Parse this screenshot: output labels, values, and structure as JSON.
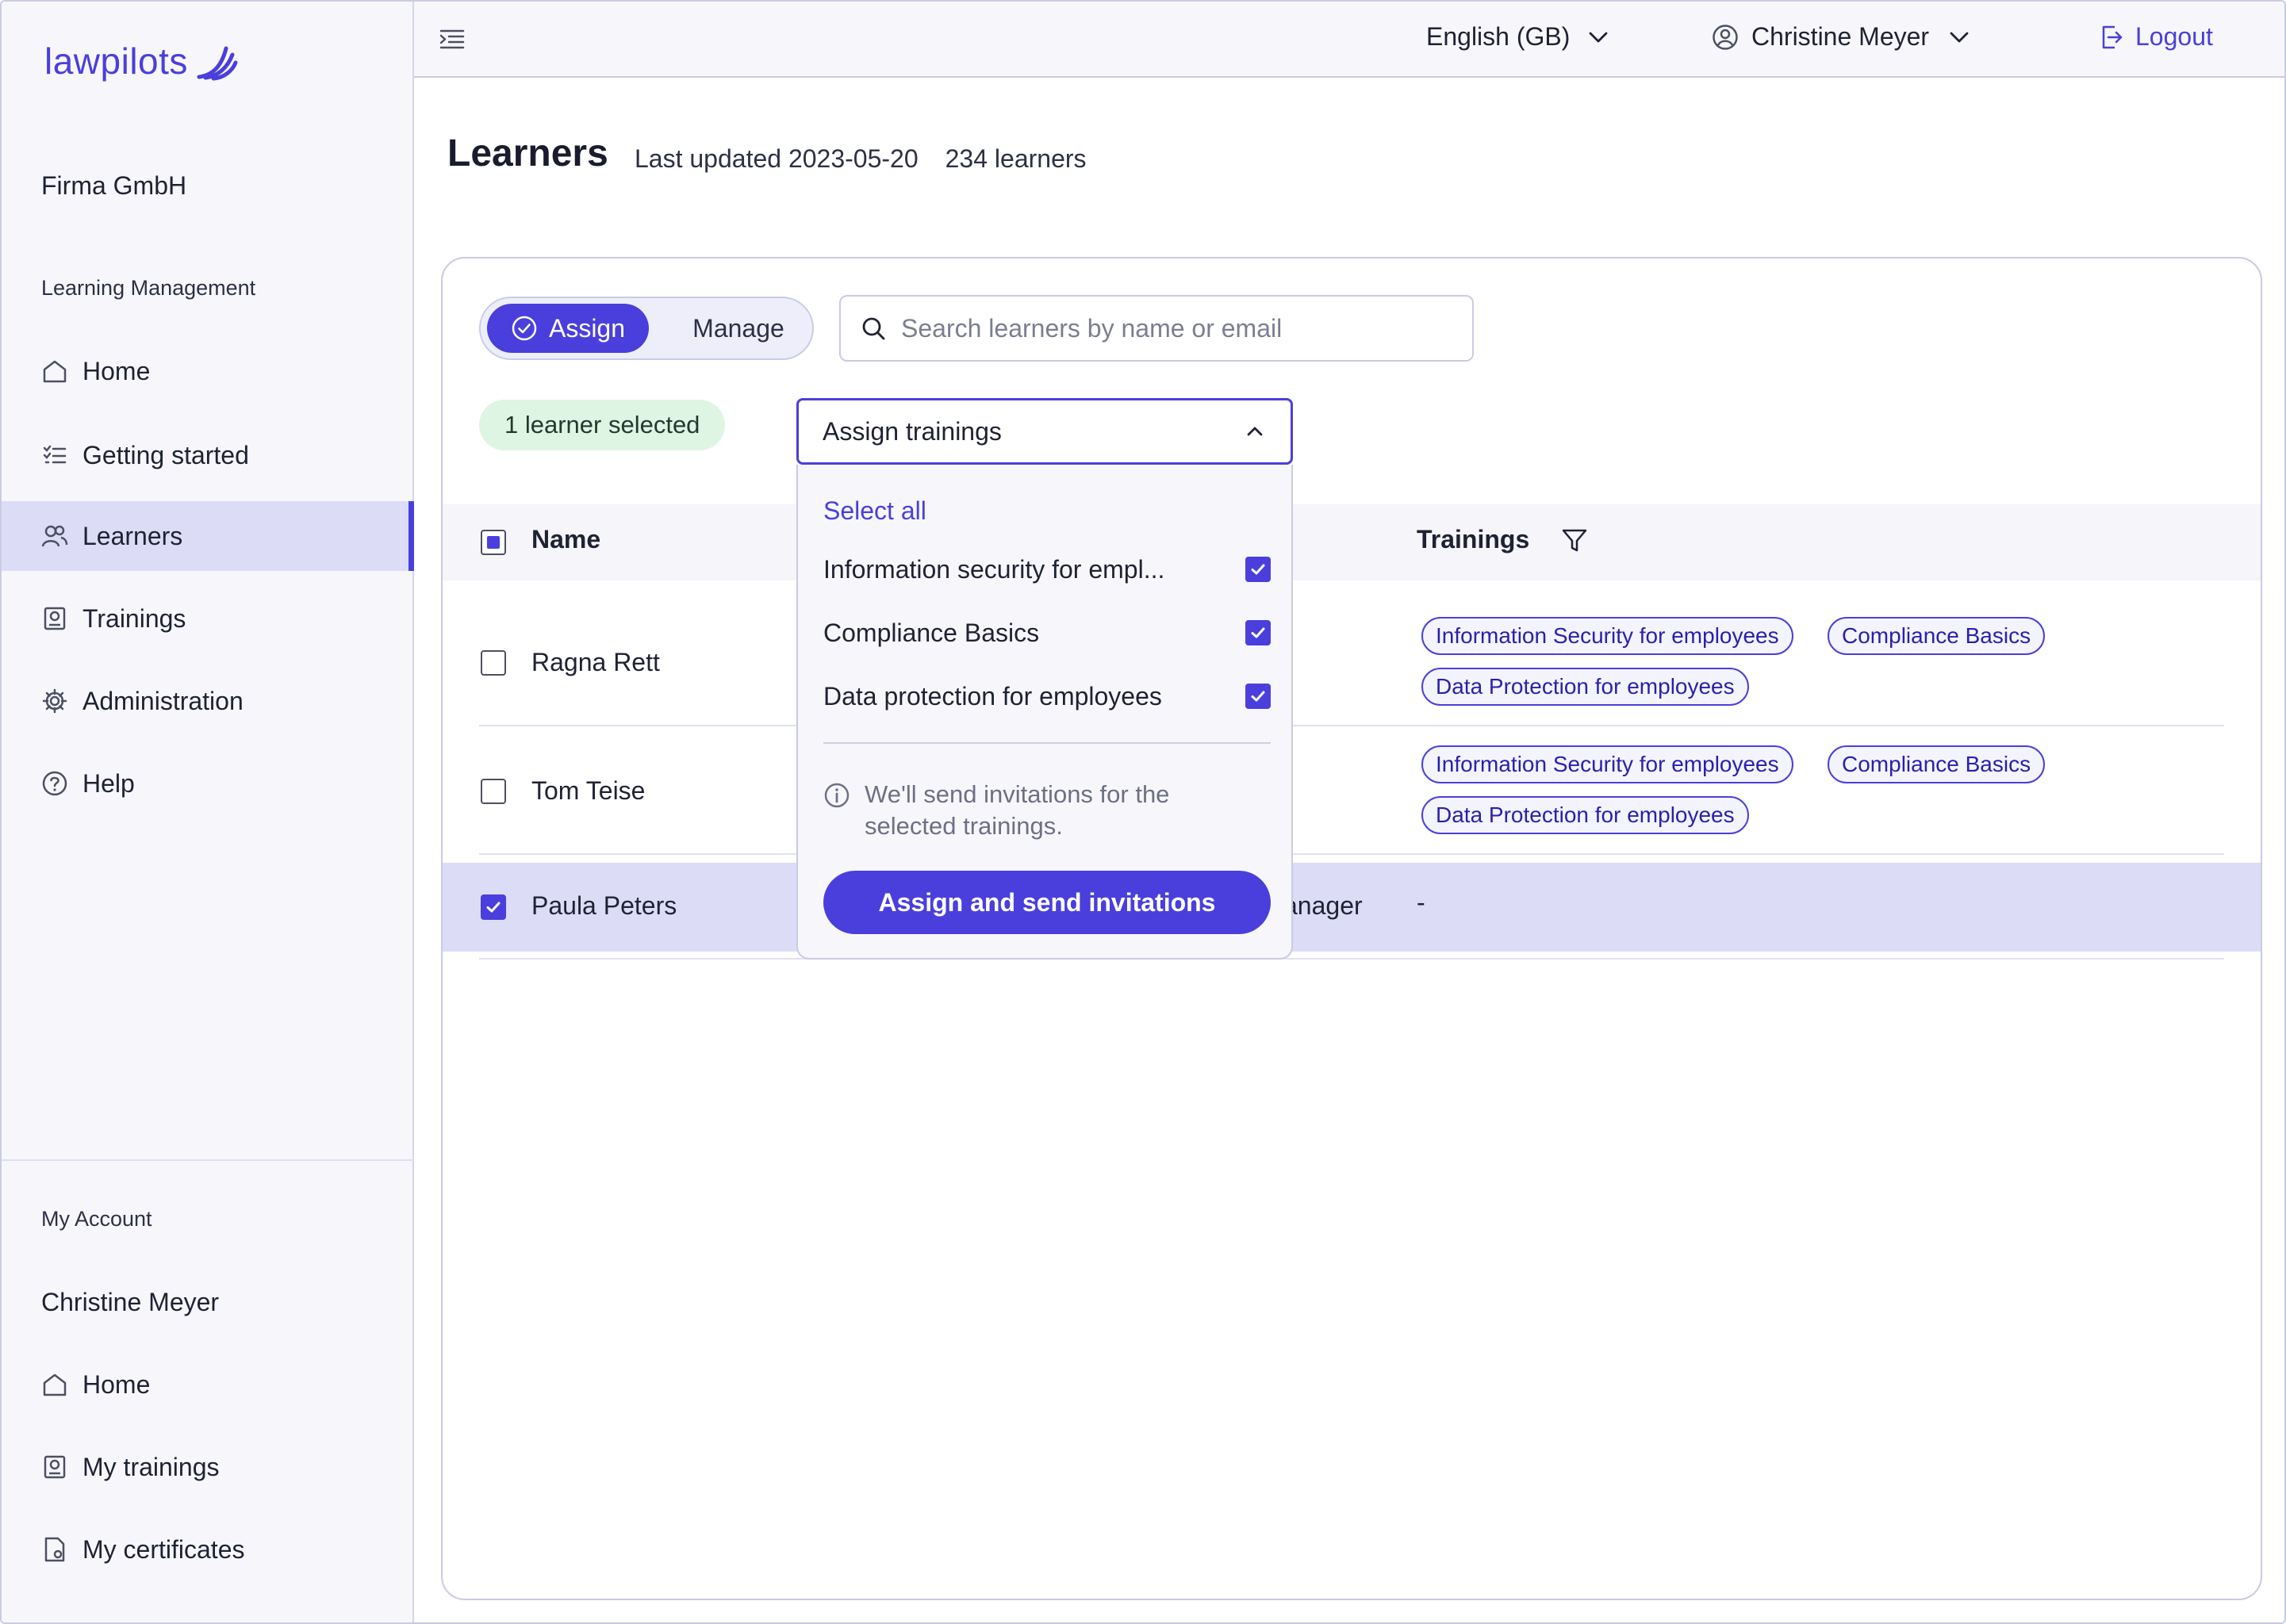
{
  "brand": {
    "name": "lawpilots",
    "color": "#4a3fdc"
  },
  "sidebar": {
    "org_name": "Firma GmbH",
    "section_learning": "Learning Management",
    "items": [
      {
        "label": "Home",
        "icon": "home-icon"
      },
      {
        "label": "Getting started",
        "icon": "checklist-icon"
      },
      {
        "label": "Learners",
        "icon": "users-icon",
        "active": true
      },
      {
        "label": "Trainings",
        "icon": "trainings-icon"
      },
      {
        "label": "Administration",
        "icon": "gear-icon"
      },
      {
        "label": "Help",
        "icon": "help-icon"
      }
    ],
    "section_account": "My Account",
    "account_name": "Christine Meyer",
    "account_items": [
      {
        "label": "Home",
        "icon": "home-icon"
      },
      {
        "label": "My trainings",
        "icon": "trainings-icon"
      },
      {
        "label": "My certificates",
        "icon": "certificate-icon"
      }
    ]
  },
  "topbar": {
    "language": "English (GB)",
    "user": "Christine Meyer",
    "logout": "Logout"
  },
  "header": {
    "title": "Learners",
    "last_updated": "Last updated 2023-05-20",
    "count": "234 learners"
  },
  "toolbar": {
    "assign_label": "Assign",
    "manage_label": "Manage",
    "search_placeholder": "Search learners by name or email",
    "selected_badge": "1 learner selected"
  },
  "table": {
    "col_name": "Name",
    "col_trainings": "Trainings",
    "rows": [
      {
        "name": "Ragna Rett",
        "checked": false,
        "tags": [
          "Information Security for employees",
          "Compliance Basics",
          "Data Protection for employees"
        ]
      },
      {
        "name": "Tom Teise",
        "checked": false,
        "tags": [
          "Information Security for employees",
          "Compliance Basics",
          "Data Protection for employees"
        ]
      },
      {
        "name": "Paula Peters",
        "checked": true,
        "role_fragment": "anager",
        "trainings_empty": "-"
      }
    ]
  },
  "dropdown": {
    "trigger_label": "Assign trainings",
    "select_all": "Select all",
    "options": [
      {
        "label": "Information security for empl...",
        "checked": true
      },
      {
        "label": "Compliance Basics",
        "checked": true
      },
      {
        "label": "Data protection for employees",
        "checked": true
      }
    ],
    "info": "We'll send invitations for the selected trainings.",
    "button": "Assign and send invitations"
  }
}
